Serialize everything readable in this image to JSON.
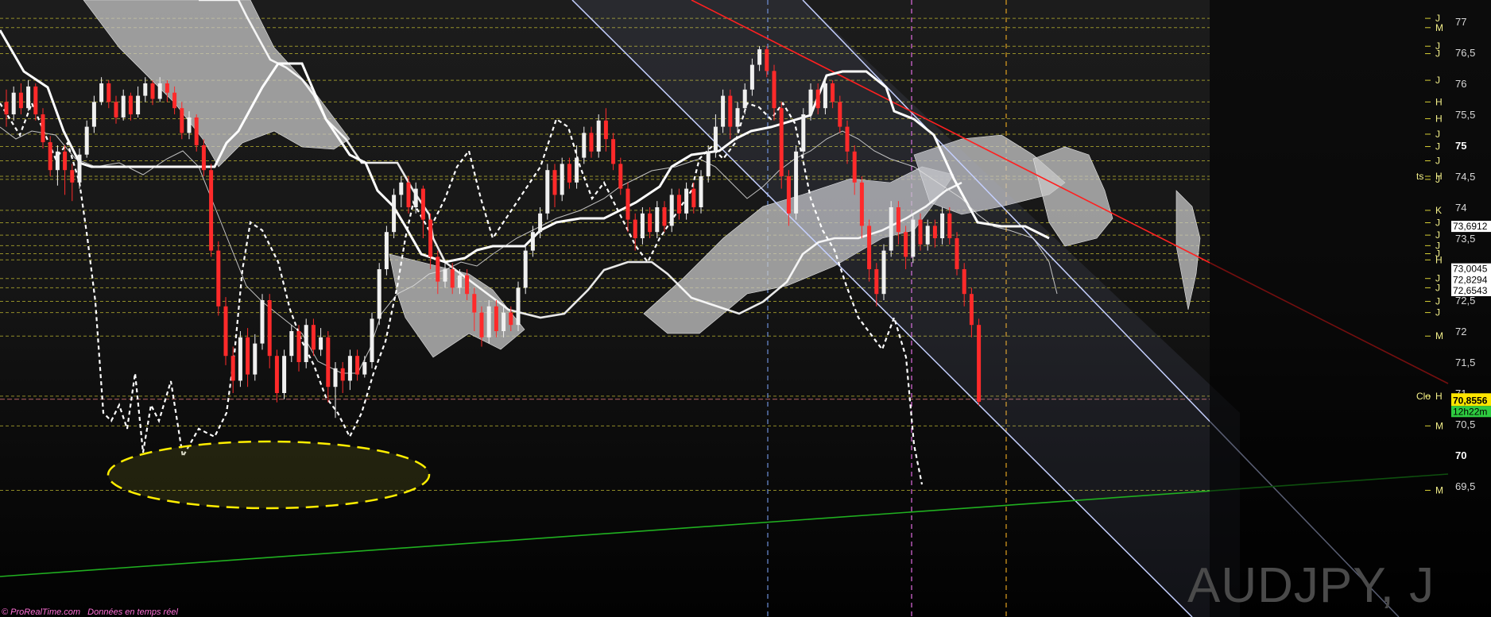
{
  "instrument": "AUDJPY, J",
  "footer": {
    "brand": "© ProRealTime.com",
    "feed": "Données en temps réel"
  },
  "colors": {
    "bull": "#f0f0f0",
    "bear": "#ff2a2a",
    "cloud": "#c8c8c8",
    "level": "#d6cf35",
    "channel": "#c5d0ff",
    "resistance": "#ff2020",
    "support": "#20b020",
    "ellipse": "#ffee00",
    "axis_bg": "#000000"
  },
  "axis": {
    "ticks": [
      "77",
      "76,5",
      "76",
      "75,5",
      "75",
      "74,5",
      "74",
      "73,5",
      "73",
      "72,5",
      "72",
      "71,5",
      "71",
      "70,5",
      "70",
      "69,5"
    ],
    "bold_ticks": [
      "75",
      "70"
    ]
  },
  "level_markers": [
    {
      "tag": "J",
      "price": 77.05
    },
    {
      "tag": "M",
      "price": 76.9
    },
    {
      "tag": "J",
      "price": 76.6
    },
    {
      "tag": "J",
      "price": 76.48
    },
    {
      "tag": "J",
      "price": 76.05
    },
    {
      "tag": "H",
      "price": 75.7
    },
    {
      "tag": "H",
      "price": 75.43
    },
    {
      "tag": "J",
      "price": 75.18
    },
    {
      "tag": "J",
      "price": 74.98
    },
    {
      "tag": "J",
      "price": 74.75
    },
    {
      "tag": "H",
      "price": 74.5
    },
    {
      "tag": "J",
      "price": 74.45
    },
    {
      "tag": "K",
      "price": 73.95
    },
    {
      "tag": "J",
      "price": 73.75
    },
    {
      "tag": "J",
      "price": 73.55
    },
    {
      "tag": "J",
      "price": 73.38
    },
    {
      "tag": "J",
      "price": 73.25
    },
    {
      "tag": "H",
      "price": 73.15
    },
    {
      "tag": "J",
      "price": 72.85
    },
    {
      "tag": "J",
      "price": 72.7
    },
    {
      "tag": "J",
      "price": 72.48
    },
    {
      "tag": "J",
      "price": 72.3
    },
    {
      "tag": "M",
      "price": 71.92
    },
    {
      "tag": "H",
      "price": 70.95
    },
    {
      "tag": "M",
      "price": 70.47
    },
    {
      "tag": "M",
      "price": 69.43
    }
  ],
  "level_annotations": {
    "ts": "ts",
    "clo": "Clo"
  },
  "price_boxes": [
    {
      "label": "73,6912",
      "value": 73.6912
    },
    {
      "label": "73,0045",
      "value": 73.0045
    },
    {
      "label": "72,8294",
      "value": 72.8294
    },
    {
      "label": "72,6543",
      "value": 72.6543
    }
  ],
  "current_price": {
    "label": "70,8556",
    "value": 70.8556
  },
  "countdown": "12h22m",
  "chart_data": {
    "type": "candlestick",
    "title": "AUDJPY, J",
    "ylim": [
      69.3,
      77.15
    ],
    "candles": [
      [
        75.7,
        75.5,
        75.9,
        75.3
      ],
      [
        75.5,
        75.85,
        75.95,
        75.4
      ],
      [
        75.85,
        75.6,
        76.0,
        75.5
      ],
      [
        75.6,
        75.95,
        76.05,
        75.55
      ],
      [
        75.95,
        75.5,
        76.0,
        75.4
      ],
      [
        75.5,
        75.05,
        75.6,
        74.95
      ],
      [
        75.05,
        74.6,
        75.15,
        74.5
      ],
      [
        74.6,
        74.9,
        75.0,
        74.35
      ],
      [
        74.9,
        74.6,
        75.0,
        74.2
      ],
      [
        74.6,
        74.4,
        74.7,
        74.1
      ],
      [
        74.4,
        74.85,
        74.95,
        74.3
      ],
      [
        74.85,
        75.3,
        75.4,
        74.8
      ],
      [
        75.3,
        75.7,
        75.8,
        75.2
      ],
      [
        75.7,
        76.0,
        76.1,
        75.65
      ],
      [
        76.0,
        75.7,
        76.05,
        75.6
      ],
      [
        75.7,
        75.45,
        75.8,
        75.35
      ],
      [
        75.45,
        75.8,
        75.9,
        75.4
      ],
      [
        75.8,
        75.5,
        75.85,
        75.4
      ],
      [
        75.5,
        75.8,
        75.95,
        75.45
      ],
      [
        75.8,
        76.0,
        76.1,
        75.7
      ],
      [
        76.0,
        75.75,
        76.05,
        75.65
      ],
      [
        75.75,
        76.0,
        76.1,
        75.7
      ],
      [
        76.0,
        75.85,
        76.05,
        75.7
      ],
      [
        75.85,
        75.6,
        75.95,
        75.5
      ],
      [
        75.6,
        75.2,
        75.7,
        75.1
      ],
      [
        75.2,
        75.45,
        75.55,
        75.1
      ],
      [
        75.45,
        75.0,
        75.5,
        74.9
      ],
      [
        75.0,
        74.6,
        75.1,
        74.5
      ],
      [
        74.6,
        73.3,
        74.7,
        73.2
      ],
      [
        73.3,
        72.4,
        73.45,
        72.25
      ],
      [
        72.4,
        71.6,
        72.55,
        71.45
      ],
      [
        71.6,
        71.2,
        71.75,
        71.0
      ],
      [
        71.2,
        71.9,
        72.0,
        71.1
      ],
      [
        71.9,
        71.3,
        72.05,
        71.1
      ],
      [
        71.3,
        71.8,
        71.95,
        71.2
      ],
      [
        71.8,
        72.5,
        72.6,
        71.7
      ],
      [
        72.5,
        71.6,
        72.6,
        71.4
      ],
      [
        71.6,
        71.0,
        71.7,
        70.85
      ],
      [
        71.0,
        71.6,
        71.7,
        70.9
      ],
      [
        71.6,
        72.0,
        72.1,
        71.5
      ],
      [
        72.0,
        71.5,
        72.1,
        71.35
      ],
      [
        71.5,
        72.1,
        72.2,
        71.4
      ],
      [
        72.1,
        71.7,
        72.2,
        71.6
      ],
      [
        71.7,
        71.9,
        72.05,
        71.6
      ],
      [
        71.9,
        71.1,
        72.0,
        70.85
      ],
      [
        71.1,
        71.4,
        71.5,
        70.6
      ],
      [
        71.4,
        71.2,
        71.5,
        71.0
      ],
      [
        71.2,
        71.6,
        71.7,
        71.05
      ],
      [
        71.6,
        71.3,
        71.7,
        71.2
      ],
      [
        71.3,
        71.5,
        71.6,
        71.25
      ],
      [
        71.5,
        72.2,
        72.3,
        71.4
      ],
      [
        72.2,
        73.0,
        73.1,
        72.1
      ],
      [
        73.0,
        73.6,
        73.7,
        72.9
      ],
      [
        73.6,
        74.2,
        74.3,
        73.5
      ],
      [
        74.2,
        74.4,
        74.5,
        74.0
      ],
      [
        74.4,
        74.0,
        74.5,
        73.9
      ],
      [
        74.0,
        74.3,
        74.4,
        73.9
      ],
      [
        74.3,
        73.8,
        74.35,
        73.5
      ],
      [
        73.8,
        73.2,
        73.9,
        73.0
      ],
      [
        73.2,
        72.8,
        73.3,
        72.6
      ],
      [
        72.8,
        73.0,
        73.1,
        72.7
      ],
      [
        73.0,
        72.7,
        73.1,
        72.6
      ],
      [
        72.7,
        72.9,
        73.0,
        72.6
      ],
      [
        72.9,
        72.6,
        73.0,
        72.5
      ],
      [
        72.6,
        72.3,
        72.7,
        72.0
      ],
      [
        72.3,
        71.9,
        72.4,
        71.75
      ],
      [
        71.9,
        72.4,
        72.5,
        71.8
      ],
      [
        72.4,
        72.0,
        72.5,
        71.9
      ],
      [
        72.0,
        72.3,
        72.4,
        71.9
      ],
      [
        72.3,
        72.1,
        72.4,
        72.0
      ],
      [
        72.1,
        72.7,
        72.8,
        72.0
      ],
      [
        72.7,
        73.3,
        73.4,
        72.6
      ],
      [
        73.3,
        73.6,
        73.7,
        73.2
      ],
      [
        73.6,
        73.9,
        74.0,
        73.5
      ],
      [
        73.9,
        74.6,
        74.7,
        73.8
      ],
      [
        74.6,
        74.2,
        74.7,
        74.0
      ],
      [
        74.2,
        74.7,
        74.8,
        74.1
      ],
      [
        74.7,
        74.4,
        74.8,
        74.3
      ],
      [
        74.4,
        74.8,
        75.0,
        74.3
      ],
      [
        74.8,
        75.2,
        75.3,
        74.7
      ],
      [
        75.2,
        74.9,
        75.3,
        74.8
      ],
      [
        74.9,
        75.4,
        75.5,
        74.8
      ],
      [
        75.4,
        75.1,
        75.6,
        74.9
      ],
      [
        75.1,
        74.7,
        75.2,
        74.6
      ],
      [
        74.7,
        74.3,
        74.8,
        74.2
      ],
      [
        74.3,
        73.8,
        74.4,
        73.6
      ],
      [
        73.8,
        73.5,
        73.9,
        73.3
      ],
      [
        73.5,
        73.9,
        74.0,
        73.4
      ],
      [
        73.9,
        73.6,
        74.0,
        73.5
      ],
      [
        73.6,
        74.0,
        74.1,
        73.5
      ],
      [
        74.0,
        73.7,
        74.1,
        73.6
      ],
      [
        73.7,
        74.2,
        74.3,
        73.6
      ],
      [
        74.2,
        73.9,
        74.3,
        73.8
      ],
      [
        73.9,
        74.3,
        74.4,
        73.8
      ],
      [
        74.3,
        74.0,
        74.4,
        73.9
      ],
      [
        74.0,
        74.5,
        74.6,
        73.9
      ],
      [
        74.5,
        74.9,
        75.0,
        74.4
      ],
      [
        74.9,
        75.3,
        75.5,
        74.8
      ],
      [
        75.3,
        75.8,
        75.9,
        75.2
      ],
      [
        75.8,
        75.3,
        75.9,
        75.1
      ],
      [
        75.3,
        75.6,
        75.7,
        75.2
      ],
      [
        75.6,
        75.9,
        76.0,
        75.5
      ],
      [
        75.9,
        76.3,
        76.4,
        75.8
      ],
      [
        76.3,
        76.55,
        76.6,
        76.2
      ],
      [
        76.55,
        76.2,
        76.6,
        76.1
      ],
      [
        76.2,
        75.6,
        76.3,
        75.4
      ],
      [
        75.6,
        74.5,
        75.7,
        74.3
      ],
      [
        74.5,
        73.9,
        74.6,
        73.7
      ],
      [
        73.9,
        74.9,
        75.0,
        73.8
      ],
      [
        74.9,
        75.5,
        75.6,
        74.8
      ],
      [
        75.5,
        75.9,
        76.0,
        75.4
      ],
      [
        75.9,
        75.6,
        76.0,
        75.5
      ],
      [
        75.6,
        76.0,
        76.1,
        75.5
      ],
      [
        76.0,
        75.7,
        76.05,
        75.6
      ],
      [
        75.7,
        75.3,
        75.8,
        75.2
      ],
      [
        75.3,
        74.9,
        75.4,
        74.7
      ],
      [
        74.9,
        74.4,
        75.0,
        74.2
      ],
      [
        74.4,
        73.7,
        74.5,
        73.5
      ],
      [
        73.7,
        73.0,
        73.8,
        72.8
      ],
      [
        73.0,
        72.6,
        73.1,
        72.4
      ],
      [
        72.6,
        73.3,
        73.4,
        72.5
      ],
      [
        73.3,
        74.0,
        74.1,
        73.2
      ],
      [
        74.0,
        73.6,
        74.1,
        73.4
      ],
      [
        73.6,
        73.2,
        73.7,
        73.0
      ],
      [
        73.2,
        73.8,
        73.9,
        73.1
      ],
      [
        73.8,
        73.4,
        73.9,
        73.3
      ],
      [
        73.4,
        73.7,
        73.8,
        73.3
      ],
      [
        73.7,
        73.5,
        73.8,
        73.35
      ],
      [
        73.5,
        73.9,
        74.0,
        73.4
      ],
      [
        73.9,
        73.5,
        74.0,
        73.4
      ],
      [
        73.5,
        73.0,
        73.6,
        72.9
      ],
      [
        73.0,
        72.6,
        73.1,
        72.4
      ],
      [
        72.6,
        72.1,
        72.7,
        71.9
      ],
      [
        72.1,
        70.86,
        72.2,
        70.8
      ]
    ]
  }
}
